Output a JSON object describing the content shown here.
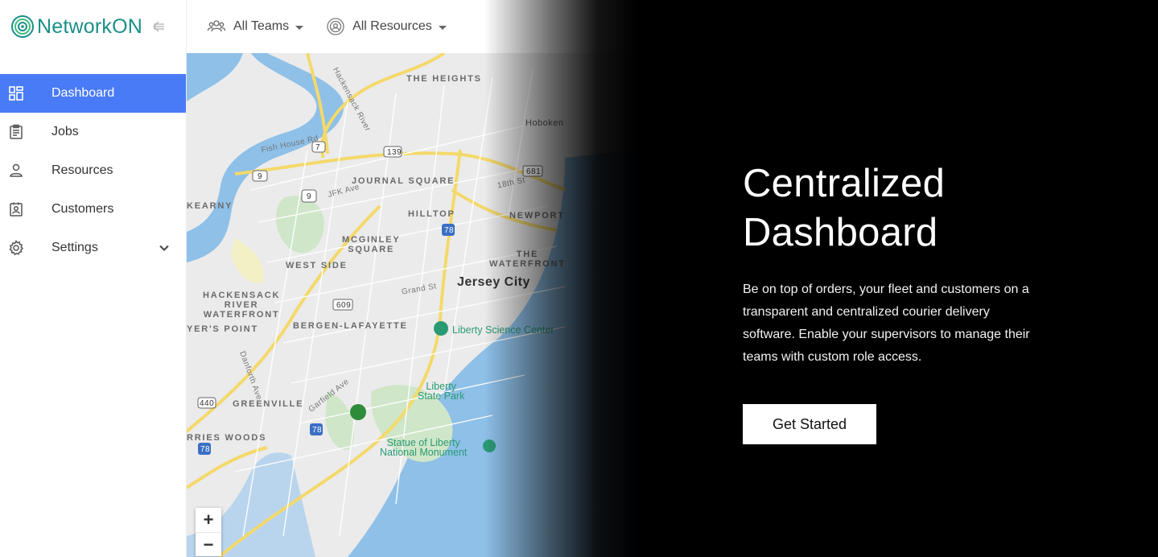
{
  "app": {
    "name": "NetworkON",
    "brand_color": "#1a8f89",
    "accent_color": "#4a7bf7"
  },
  "sidebar": {
    "collapse_icon": "arrow-left-collapse-icon",
    "items": [
      {
        "label": "Dashboard",
        "icon": "dashboard-grid-icon",
        "active": true
      },
      {
        "label": "Jobs",
        "icon": "clipboard-icon",
        "active": false
      },
      {
        "label": "Resources",
        "icon": "person-icon",
        "active": false
      },
      {
        "label": "Customers",
        "icon": "contact-card-icon",
        "active": false
      },
      {
        "label": "Settings",
        "icon": "gear-icon",
        "active": false,
        "expandable": true
      }
    ]
  },
  "topbar": {
    "teams_filter": {
      "label": "All Teams",
      "icon": "group-icon"
    },
    "resources_filter": {
      "label": "All Resources",
      "icon": "target-icon"
    }
  },
  "map": {
    "labels": {
      "the_heights": "THE HEIGHTS",
      "hoboken": "Hoboken",
      "journal_square": "JOURNAL SQUARE",
      "hilltop": "HILLTOP",
      "newport": "NEWPORT",
      "kearny": "KEARNY",
      "mcginley": "MCGINLEY\nSQUARE",
      "west_side": "WEST SIDE",
      "the_waterfront": "THE\nWATERFRONT",
      "jersey_city": "Jersey City",
      "hackensack": "HACKENSACK\nRIVER\nWATERFRONT",
      "yers_point": "YER'S POINT",
      "bergen_lafayette": "BERGEN-LAFAYETTE",
      "liberty_science": "Liberty Science Center",
      "liberty_state_park": "Liberty\nState Park",
      "greenville": "GREENVILLE",
      "rries_woods": "RRIES WOODS",
      "statue_liberty": "Statue of Liberty\nNational Monument",
      "hackensack_river": "Hackensack River",
      "fish_house_rd": "Fish House Rd",
      "route_7": "7",
      "route_139": "139",
      "route_9": "9",
      "route_9b": "9",
      "route_681": "681",
      "route_609": "609",
      "route_78a": "78",
      "route_78b": "78",
      "route_78c": "78",
      "route_440": "440",
      "grand_st": "Grand St",
      "garfield_ave": "Garfield Ave",
      "danforth_ave": "Danforth Ave",
      "tp_ave": "JFK Ave",
      "18th_st": "18th St"
    },
    "zoom_in": "+",
    "zoom_out": "−"
  },
  "hero": {
    "title_line1": "Centralized",
    "title_line2": "Dashboard",
    "description": "Be on top of orders, your fleet and customers on a transparent and centralized courier delivery software. Enable your supervisors to manage their teams with custom role access.",
    "cta_label": "Get Started"
  }
}
